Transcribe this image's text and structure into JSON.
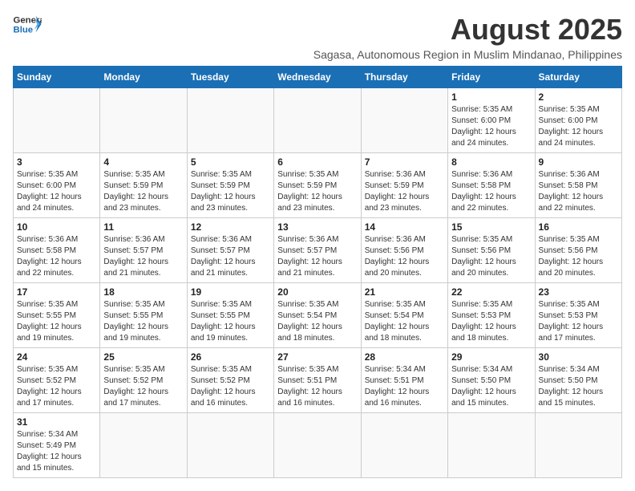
{
  "header": {
    "logo_general": "General",
    "logo_blue": "Blue",
    "title": "August 2025",
    "subtitle": "Sagasa, Autonomous Region in Muslim Mindanao, Philippines"
  },
  "calendar": {
    "days_of_week": [
      "Sunday",
      "Monday",
      "Tuesday",
      "Wednesday",
      "Thursday",
      "Friday",
      "Saturday"
    ],
    "weeks": [
      [
        {
          "day": "",
          "info": ""
        },
        {
          "day": "",
          "info": ""
        },
        {
          "day": "",
          "info": ""
        },
        {
          "day": "",
          "info": ""
        },
        {
          "day": "",
          "info": ""
        },
        {
          "day": "1",
          "info": "Sunrise: 5:35 AM\nSunset: 6:00 PM\nDaylight: 12 hours and 24 minutes."
        },
        {
          "day": "2",
          "info": "Sunrise: 5:35 AM\nSunset: 6:00 PM\nDaylight: 12 hours and 24 minutes."
        }
      ],
      [
        {
          "day": "3",
          "info": "Sunrise: 5:35 AM\nSunset: 6:00 PM\nDaylight: 12 hours and 24 minutes."
        },
        {
          "day": "4",
          "info": "Sunrise: 5:35 AM\nSunset: 5:59 PM\nDaylight: 12 hours and 23 minutes."
        },
        {
          "day": "5",
          "info": "Sunrise: 5:35 AM\nSunset: 5:59 PM\nDaylight: 12 hours and 23 minutes."
        },
        {
          "day": "6",
          "info": "Sunrise: 5:35 AM\nSunset: 5:59 PM\nDaylight: 12 hours and 23 minutes."
        },
        {
          "day": "7",
          "info": "Sunrise: 5:36 AM\nSunset: 5:59 PM\nDaylight: 12 hours and 23 minutes."
        },
        {
          "day": "8",
          "info": "Sunrise: 5:36 AM\nSunset: 5:58 PM\nDaylight: 12 hours and 22 minutes."
        },
        {
          "day": "9",
          "info": "Sunrise: 5:36 AM\nSunset: 5:58 PM\nDaylight: 12 hours and 22 minutes."
        }
      ],
      [
        {
          "day": "10",
          "info": "Sunrise: 5:36 AM\nSunset: 5:58 PM\nDaylight: 12 hours and 22 minutes."
        },
        {
          "day": "11",
          "info": "Sunrise: 5:36 AM\nSunset: 5:57 PM\nDaylight: 12 hours and 21 minutes."
        },
        {
          "day": "12",
          "info": "Sunrise: 5:36 AM\nSunset: 5:57 PM\nDaylight: 12 hours and 21 minutes."
        },
        {
          "day": "13",
          "info": "Sunrise: 5:36 AM\nSunset: 5:57 PM\nDaylight: 12 hours and 21 minutes."
        },
        {
          "day": "14",
          "info": "Sunrise: 5:36 AM\nSunset: 5:56 PM\nDaylight: 12 hours and 20 minutes."
        },
        {
          "day": "15",
          "info": "Sunrise: 5:35 AM\nSunset: 5:56 PM\nDaylight: 12 hours and 20 minutes."
        },
        {
          "day": "16",
          "info": "Sunrise: 5:35 AM\nSunset: 5:56 PM\nDaylight: 12 hours and 20 minutes."
        }
      ],
      [
        {
          "day": "17",
          "info": "Sunrise: 5:35 AM\nSunset: 5:55 PM\nDaylight: 12 hours and 19 minutes."
        },
        {
          "day": "18",
          "info": "Sunrise: 5:35 AM\nSunset: 5:55 PM\nDaylight: 12 hours and 19 minutes."
        },
        {
          "day": "19",
          "info": "Sunrise: 5:35 AM\nSunset: 5:55 PM\nDaylight: 12 hours and 19 minutes."
        },
        {
          "day": "20",
          "info": "Sunrise: 5:35 AM\nSunset: 5:54 PM\nDaylight: 12 hours and 18 minutes."
        },
        {
          "day": "21",
          "info": "Sunrise: 5:35 AM\nSunset: 5:54 PM\nDaylight: 12 hours and 18 minutes."
        },
        {
          "day": "22",
          "info": "Sunrise: 5:35 AM\nSunset: 5:53 PM\nDaylight: 12 hours and 18 minutes."
        },
        {
          "day": "23",
          "info": "Sunrise: 5:35 AM\nSunset: 5:53 PM\nDaylight: 12 hours and 17 minutes."
        }
      ],
      [
        {
          "day": "24",
          "info": "Sunrise: 5:35 AM\nSunset: 5:52 PM\nDaylight: 12 hours and 17 minutes."
        },
        {
          "day": "25",
          "info": "Sunrise: 5:35 AM\nSunset: 5:52 PM\nDaylight: 12 hours and 17 minutes."
        },
        {
          "day": "26",
          "info": "Sunrise: 5:35 AM\nSunset: 5:52 PM\nDaylight: 12 hours and 16 minutes."
        },
        {
          "day": "27",
          "info": "Sunrise: 5:35 AM\nSunset: 5:51 PM\nDaylight: 12 hours and 16 minutes."
        },
        {
          "day": "28",
          "info": "Sunrise: 5:34 AM\nSunset: 5:51 PM\nDaylight: 12 hours and 16 minutes."
        },
        {
          "day": "29",
          "info": "Sunrise: 5:34 AM\nSunset: 5:50 PM\nDaylight: 12 hours and 15 minutes."
        },
        {
          "day": "30",
          "info": "Sunrise: 5:34 AM\nSunset: 5:50 PM\nDaylight: 12 hours and 15 minutes."
        }
      ],
      [
        {
          "day": "31",
          "info": "Sunrise: 5:34 AM\nSunset: 5:49 PM\nDaylight: 12 hours and 15 minutes."
        },
        {
          "day": "",
          "info": ""
        },
        {
          "day": "",
          "info": ""
        },
        {
          "day": "",
          "info": ""
        },
        {
          "day": "",
          "info": ""
        },
        {
          "day": "",
          "info": ""
        },
        {
          "day": "",
          "info": ""
        }
      ]
    ]
  }
}
